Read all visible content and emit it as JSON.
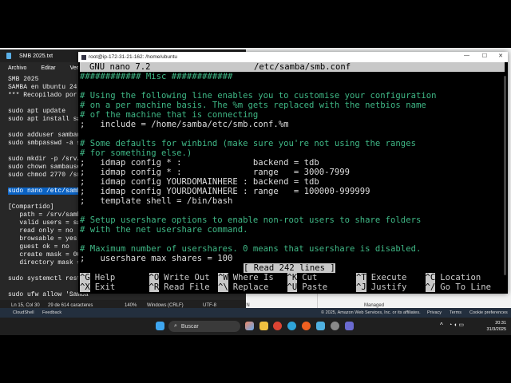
{
  "notepad": {
    "title": "SMB 2025.txt",
    "menu": [
      "Archivo",
      "Editar",
      "Ver"
    ],
    "lines": [
      "SMB 2025",
      "SAMBA en Ubuntu 24.",
      "*** Recopilado por:",
      "",
      "sudo apt update",
      "sudo apt install sa",
      "",
      "sudo adduser sambau",
      "sudo smbpasswd -a s",
      "",
      "sudo mkdir -p /srv/",
      "sudo chown sambause",
      "sudo chmod 2770 /sr",
      "",
      "sudo nano /etc/samb",
      "",
      "[Compartido]",
      "   path = /srv/samb",
      "   valid users = sa",
      "   read only = no",
      "   browsable = yes",
      "   guest ok = no",
      "   create mask = 06",
      "   directory mask =",
      "",
      "sudo systemctl rest",
      "",
      "sudo ufw allow 'Samba"
    ],
    "status": {
      "position": "Ln 15, Col 30",
      "chars": "29 de 614 caracteres",
      "zoom": "140%",
      "eol": "Windows (CRLF)",
      "encoding": "UTF-8"
    }
  },
  "terminal": {
    "title": "root@ip-172-31-21-162: /home/ubuntu",
    "controls": [
      "—",
      "☐",
      "✕"
    ],
    "header_left": "GNU nano 7.2",
    "header_file": "/etc/samba/smb.conf",
    "lines": [
      {
        "t": "############ Misc ############",
        "c": "misc"
      },
      {
        "t": "",
        "c": ""
      },
      {
        "t": "# Using the following line enables you to customise your configuration",
        "c": "cm"
      },
      {
        "t": "# on a per machine basis. The %m gets replaced with the netbios name",
        "c": "cm"
      },
      {
        "t": "# of the machine that is connecting",
        "c": "cm"
      },
      {
        "t": ";   include = /home/samba/etc/smb.conf.%m",
        "c": ""
      },
      {
        "t": "",
        "c": ""
      },
      {
        "t": "# Some defaults for winbind (make sure you're not using the ranges",
        "c": "cm"
      },
      {
        "t": "# for something else.)",
        "c": "cm"
      },
      {
        "t": ";   idmap config * :              backend = tdb",
        "c": ""
      },
      {
        "t": ";   idmap config * :              range   = 3000-7999",
        "c": ""
      },
      {
        "t": ";   idmap config YOURDOMAINHERE : backend = tdb",
        "c": ""
      },
      {
        "t": ";   idmap config YOURDOMAINHERE : range   = 100000-999999",
        "c": ""
      },
      {
        "t": ";   template shell = /bin/bash",
        "c": ""
      },
      {
        "t": "",
        "c": ""
      },
      {
        "t": "# Setup usershare options to enable non-root users to share folders",
        "c": "cm"
      },
      {
        "t": "# with the net usershare command.",
        "c": "cm"
      },
      {
        "t": "",
        "c": ""
      },
      {
        "t": "# Maximum number of usershares. 0 means that usershare is disabled.",
        "c": "cm"
      },
      {
        "t": ";   usershare max shares = 100",
        "c": ""
      }
    ],
    "status": "[ Read 242 lines ]",
    "help": [
      [
        "^G",
        "Help"
      ],
      [
        "^O",
        "Write Out"
      ],
      [
        "^W",
        "Where Is"
      ],
      [
        "^K",
        "Cut"
      ],
      [
        "^T",
        "Execute"
      ],
      [
        "^C",
        "Location"
      ],
      [
        "^X",
        "Exit"
      ],
      [
        "^R",
        "Read File"
      ],
      [
        "^\\",
        "Replace"
      ],
      [
        "^U",
        "Paste"
      ],
      [
        "^J",
        "Justify"
      ],
      [
        "^/",
        "Go To Line"
      ]
    ]
  },
  "aws": {
    "label_left": "ARN",
    "label_right": "Managed",
    "footer": {
      "cloudshell": "CloudShell",
      "feedback": "Feedback",
      "copyright": "© 2025, Amazon Web Services, Inc. or its affiliates.",
      "privacy": "Privacy",
      "terms": "Terms",
      "cookies": "Cookie preferences"
    }
  },
  "taskbar": {
    "search": "Buscar",
    "time": "20:31",
    "date": "31/3/2025"
  }
}
